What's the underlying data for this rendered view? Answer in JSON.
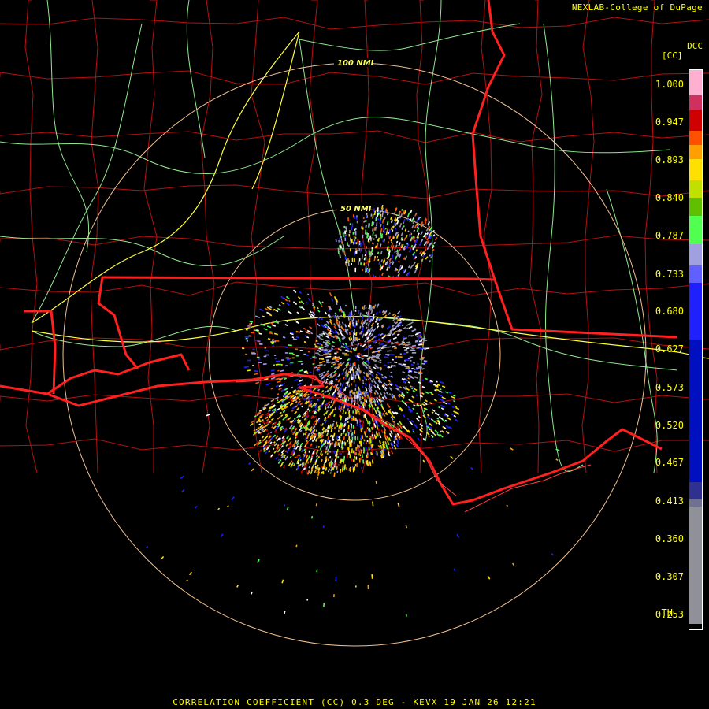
{
  "header": {
    "credit": "NEXLAB-College of DuPage",
    "site_tag": "DCC",
    "unit": "[CC]"
  },
  "rings": [
    {
      "label": "100 NMI"
    },
    {
      "label": "50 NMI"
    }
  ],
  "legend": {
    "ticks": [
      {
        "label": "1.000",
        "value": 1.0
      },
      {
        "label": "0.947",
        "value": 0.947
      },
      {
        "label": "0.893",
        "value": 0.893
      },
      {
        "label": "0.840",
        "value": 0.84
      },
      {
        "label": "0.787",
        "value": 0.787
      },
      {
        "label": "0.733",
        "value": 0.733
      },
      {
        "label": "0.680",
        "value": 0.68
      },
      {
        "label": "0.627",
        "value": 0.627
      },
      {
        "label": "0.573",
        "value": 0.573
      },
      {
        "label": "0.520",
        "value": 0.52
      },
      {
        "label": "0.467",
        "value": 0.467
      },
      {
        "label": "0.413",
        "value": 0.413
      },
      {
        "label": "0.360",
        "value": 0.36
      },
      {
        "label": "0.307",
        "value": 0.307
      },
      {
        "label": "0.253",
        "value": 0.253
      }
    ],
    "threshold_label": "TH",
    "color_stops": [
      {
        "from": 1.02,
        "to": 0.985,
        "color": "#ffb0d0"
      },
      {
        "from": 0.985,
        "to": 0.965,
        "color": "#d03060"
      },
      {
        "from": 0.965,
        "to": 0.935,
        "color": "#d00000"
      },
      {
        "from": 0.935,
        "to": 0.915,
        "color": "#ff5000"
      },
      {
        "from": 0.915,
        "to": 0.895,
        "color": "#ffa000"
      },
      {
        "from": 0.895,
        "to": 0.865,
        "color": "#ffe000"
      },
      {
        "from": 0.865,
        "to": 0.84,
        "color": "#c0e000"
      },
      {
        "from": 0.84,
        "to": 0.815,
        "color": "#60c000"
      },
      {
        "from": 0.815,
        "to": 0.775,
        "color": "#50ff50"
      },
      {
        "from": 0.775,
        "to": 0.745,
        "color": "#a0a0e0"
      },
      {
        "from": 0.745,
        "to": 0.72,
        "color": "#6060ff"
      },
      {
        "from": 0.72,
        "to": 0.64,
        "color": "#2020ff"
      },
      {
        "from": 0.64,
        "to": 0.44,
        "color": "#0010c0"
      },
      {
        "from": 0.44,
        "to": 0.415,
        "color": "#303090"
      },
      {
        "from": 0.415,
        "to": 0.405,
        "color": "#707090"
      },
      {
        "from": 0.405,
        "to": 0.24,
        "color": "#909098"
      },
      {
        "from": 0.24,
        "to": 0.23,
        "color": "#000000"
      }
    ]
  },
  "caption": "CORRELATION COEFFICIENT (CC) 0.3 DEG - KEVX 19 JAN 26 12:21",
  "colors": {
    "text": "#ffff00",
    "state_border": "#ff2020",
    "county_border": "#c01010",
    "highway": "#90e890",
    "interstate": "#ffff40",
    "range_ring": "#f0c090"
  },
  "radar": {
    "site": "KEVX",
    "elevation_deg": 0.3
  }
}
